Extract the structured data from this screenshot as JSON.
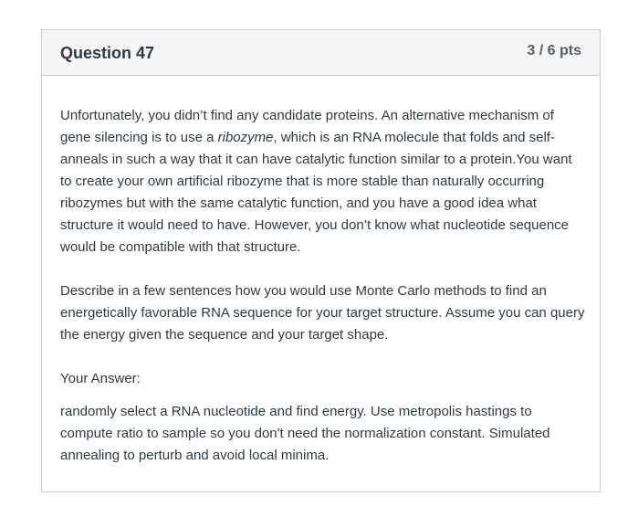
{
  "question": {
    "title": "Question 47",
    "points": "3 / 6 pts",
    "paragraph1": {
      "before_em": "Unfortunately, you didn’t find any candidate proteins. An alternative mechanism of gene silencing is to use a ",
      "em": "ribozyme",
      "after_em": ", which is an RNA molecule that folds and self-anneals in such a way that it can have catalytic function similar to a protein.You want to create your own artificial ribozyme that is more stable than naturally occurring ribozymes but with the same catalytic function, and you have a good idea what structure it would need to have. However, you don’t know what nucleotide sequence would be compatible with that structure."
    },
    "paragraph2": "Describe in a few sentences how you would use Monte Carlo methods to find an energetically favorable RNA sequence for your target structure. Assume you can query the energy given the sequence and your target shape.",
    "answer_label": "Your Answer:",
    "answer_text": "randomly select a RNA nucleotide and find energy. Use metropolis hastings to compute ratio to sample so you don't need the normalization constant. Simulated annealing to perturb and avoid local minima."
  }
}
